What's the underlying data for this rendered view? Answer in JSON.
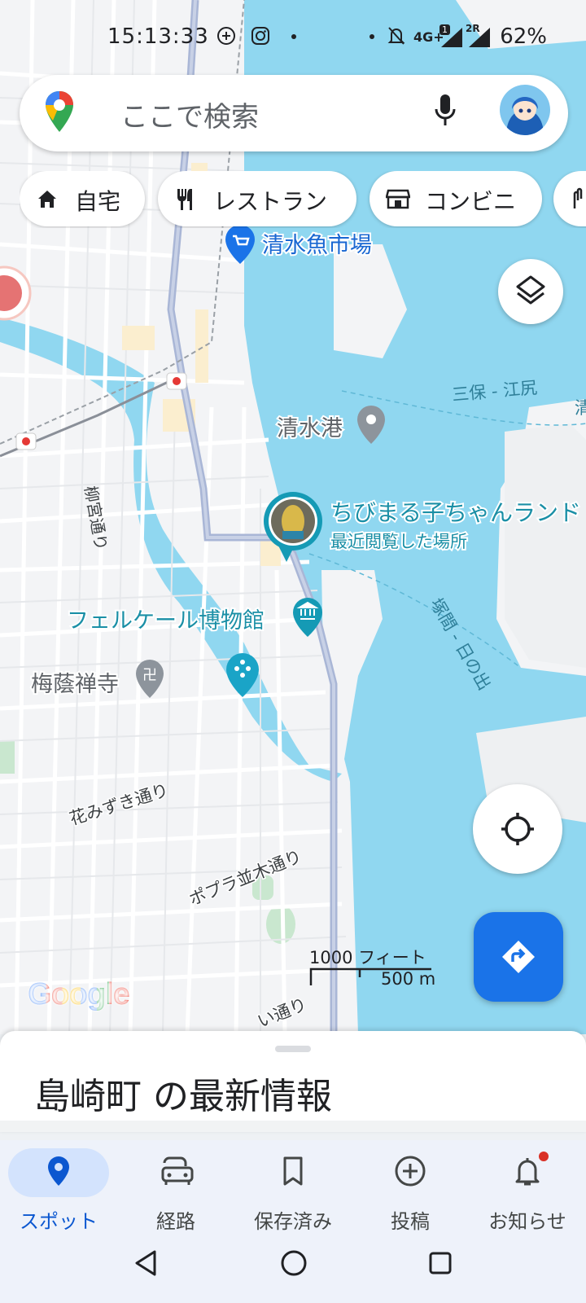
{
  "status_bar": {
    "time": "15:13:33",
    "network": "4G+",
    "sim1_badge": "1",
    "sim2_label": "2R",
    "battery": "62%"
  },
  "search": {
    "placeholder": "ここで検索"
  },
  "chips": [
    {
      "label": "自宅",
      "icon": "home-icon"
    },
    {
      "label": "レストラン",
      "icon": "restaurant-icon"
    },
    {
      "label": "コンビニ",
      "icon": "convenience-store-icon"
    }
  ],
  "map": {
    "places": {
      "fish_market": "清水魚市場",
      "port": "清水港",
      "recent_place": "ちびまる子ちゃんランド",
      "recent_place_caption": "最近閲覧した場所",
      "museum": "フェルケール博物館",
      "temple": "梅蔭禅寺"
    },
    "areas": {
      "miho": "三保 - 江尻",
      "tsukama": "塚間 - 日の出",
      "edge": "清"
    },
    "roads": {
      "yanagimiya": "柳宮通り",
      "hanamizuki": "花みずき通り",
      "popura": "ポプラ並木通り",
      "bottom": "い通り"
    },
    "scale": {
      "feet": "1000 フィート",
      "meters": "500 m"
    },
    "google_logo": "Google",
    "colors": {
      "water": "#90d7f0",
      "land": "#f3f4f6",
      "road": "#ffffff",
      "highway": "#a9b6d6",
      "accent": "#1a73e8"
    }
  },
  "sheet": {
    "title": "島崎町 の最新情報"
  },
  "nav": [
    {
      "label": "スポット",
      "icon": "explore-pin-icon",
      "active": true
    },
    {
      "label": "経路",
      "icon": "commute-car-icon",
      "active": false
    },
    {
      "label": "保存済み",
      "icon": "bookmark-icon",
      "active": false
    },
    {
      "label": "投稿",
      "icon": "add-circle-icon",
      "active": false
    },
    {
      "label": "お知らせ",
      "icon": "bell-icon",
      "active": false
    }
  ]
}
